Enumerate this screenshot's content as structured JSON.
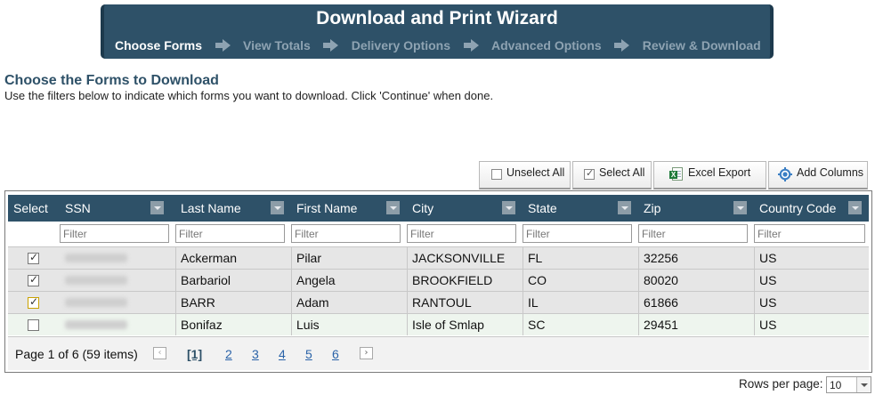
{
  "wizard": {
    "title": "Download and Print Wizard",
    "steps": [
      {
        "label": "Choose Forms",
        "active": true
      },
      {
        "label": "View Totals",
        "active": false
      },
      {
        "label": "Delivery Options",
        "active": false
      },
      {
        "label": "Advanced Options",
        "active": false
      },
      {
        "label": "Review & Download",
        "active": false
      }
    ]
  },
  "page": {
    "heading": "Choose the Forms to Download",
    "subtext": "Use the filters below to indicate which forms you want to download. Click 'Continue' when done."
  },
  "toolbar": {
    "unselect_all": "Unselect All",
    "select_all": "Select All",
    "excel_export": "Excel Export",
    "add_columns": "Add Columns"
  },
  "grid": {
    "columns": [
      "Select",
      "SSN",
      "Last Name",
      "First Name",
      "City",
      "State",
      "Zip",
      "Country Code"
    ],
    "filter_placeholder": "Filter",
    "rows": [
      {
        "checked": true,
        "last": "Ackerman",
        "first": "Pilar",
        "city": "JACKSONVILLE",
        "state": "FL",
        "zip": "32256",
        "country": "US"
      },
      {
        "checked": true,
        "last": "Barbariol",
        "first": "Angela",
        "city": "BROOKFIELD",
        "state": "CO",
        "zip": "80020",
        "country": "US"
      },
      {
        "checked": true,
        "last": "BARR",
        "first": "Adam",
        "city": "RANTOUL",
        "state": "IL",
        "zip": "61866",
        "country": "US"
      },
      {
        "checked": false,
        "last": "Bonifaz",
        "first": "Luis",
        "city": "Isle of Smlap",
        "state": "SC",
        "zip": "29451",
        "country": "US"
      }
    ]
  },
  "pager": {
    "info": "Page 1 of 6 (59 items)",
    "current": "[1]",
    "pages": [
      "2",
      "3",
      "4",
      "5",
      "6"
    ],
    "prev_icon": "‹",
    "next_icon": "›"
  },
  "rows_per_page": {
    "label": "Rows per page:",
    "value": "10"
  }
}
